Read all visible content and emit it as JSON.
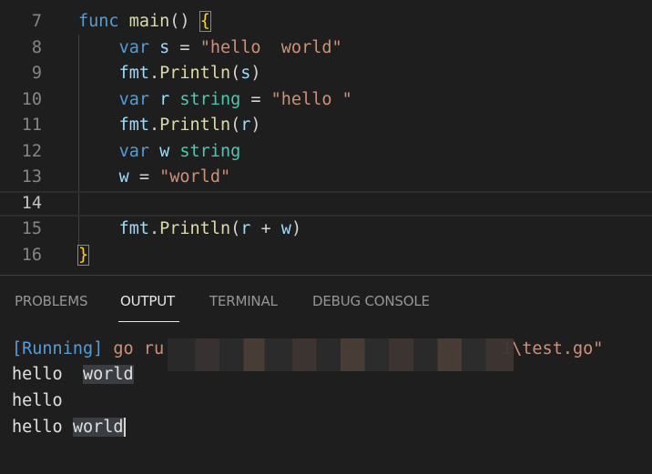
{
  "editor": {
    "lines": [
      {
        "num": "7",
        "tokens": [
          [
            "kw",
            "func"
          ],
          [
            "plain",
            " "
          ],
          [
            "fn",
            "main"
          ],
          [
            "plain",
            "() "
          ],
          [
            "brace",
            "{"
          ]
        ]
      },
      {
        "num": "8",
        "tokens": [
          [
            "plain",
            "    "
          ],
          [
            "kw",
            "var"
          ],
          [
            "plain",
            " "
          ],
          [
            "var",
            "s"
          ],
          [
            "plain",
            " = "
          ],
          [
            "str",
            "\"hello  world\""
          ]
        ]
      },
      {
        "num": "9",
        "tokens": [
          [
            "plain",
            "    "
          ],
          [
            "var",
            "fmt"
          ],
          [
            "plain",
            "."
          ],
          [
            "fn",
            "Println"
          ],
          [
            "plain",
            "("
          ],
          [
            "var",
            "s"
          ],
          [
            "plain",
            ")"
          ]
        ]
      },
      {
        "num": "10",
        "tokens": [
          [
            "plain",
            "    "
          ],
          [
            "kw",
            "var"
          ],
          [
            "plain",
            " "
          ],
          [
            "var",
            "r"
          ],
          [
            "plain",
            " "
          ],
          [
            "type",
            "string"
          ],
          [
            "plain",
            " = "
          ],
          [
            "str",
            "\"hello \""
          ]
        ]
      },
      {
        "num": "11",
        "tokens": [
          [
            "plain",
            "    "
          ],
          [
            "var",
            "fmt"
          ],
          [
            "plain",
            "."
          ],
          [
            "fn",
            "Println"
          ],
          [
            "plain",
            "("
          ],
          [
            "var",
            "r"
          ],
          [
            "plain",
            ")"
          ]
        ]
      },
      {
        "num": "12",
        "tokens": [
          [
            "plain",
            "    "
          ],
          [
            "kw",
            "var"
          ],
          [
            "plain",
            " "
          ],
          [
            "var",
            "w"
          ],
          [
            "plain",
            " "
          ],
          [
            "type",
            "string"
          ]
        ]
      },
      {
        "num": "13",
        "tokens": [
          [
            "plain",
            "    "
          ],
          [
            "var",
            "w"
          ],
          [
            "plain",
            " = "
          ],
          [
            "str",
            "\"world\""
          ]
        ]
      },
      {
        "num": "14",
        "tokens": []
      },
      {
        "num": "15",
        "tokens": [
          [
            "plain",
            "    "
          ],
          [
            "var",
            "fmt"
          ],
          [
            "plain",
            "."
          ],
          [
            "fn",
            "Println"
          ],
          [
            "plain",
            "("
          ],
          [
            "var",
            "r"
          ],
          [
            "plain",
            " + "
          ],
          [
            "var",
            "w"
          ],
          [
            "plain",
            ")"
          ]
        ]
      },
      {
        "num": "16",
        "tokens": [
          [
            "brace",
            "}"
          ]
        ]
      }
    ]
  },
  "panel": {
    "tabs": [
      {
        "label": "PROBLEMS"
      },
      {
        "label": "OUTPUT"
      },
      {
        "label": "TERMINAL"
      },
      {
        "label": "DEBUG CONSOLE"
      }
    ],
    "output": {
      "running_tag": "[Running]",
      "cmd_start": "go ru",
      "cmd_end": "1\\test.go\"",
      "line1_a": "hello  ",
      "line1_b": "world",
      "line2": "hello",
      "line3_a": "hello ",
      "line3_b": "world"
    }
  }
}
